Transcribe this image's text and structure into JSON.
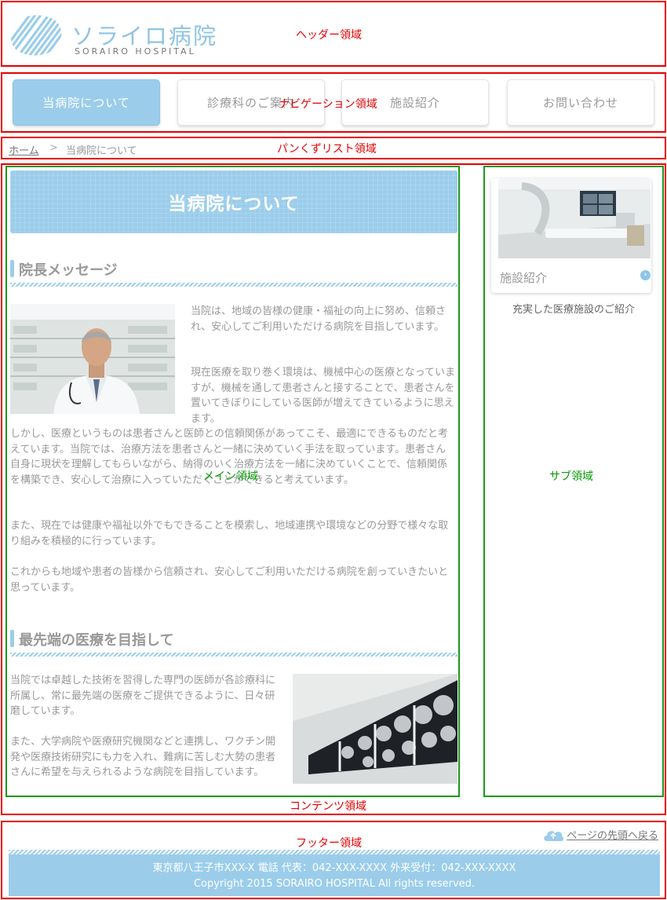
{
  "header": {
    "logo_jp": "ソライロ病院",
    "logo_en": "SORAIRO HOSPITAL",
    "region_label": "ヘッダー領域"
  },
  "nav": {
    "items": [
      {
        "label": "当病院について",
        "active": true
      },
      {
        "label": "診療科のご案内",
        "active": false
      },
      {
        "label": "施設紹介",
        "active": false
      },
      {
        "label": "お問い合わせ",
        "active": false
      }
    ],
    "region_label": "ナビゲーション領域"
  },
  "breadcrumb": {
    "home": "ホーム",
    "separator": ">",
    "current": "当病院について",
    "region_label": "パンくずリスト領域"
  },
  "main": {
    "page_title": "当病院について",
    "region_label": "メイン領域",
    "section1": {
      "heading": "院長メッセージ",
      "para_right": "当院は、地域の皆様の健康・福祉の向上に努め、信頼され、安心してご利用いただける病院を目指しています。",
      "para_right2": "現在医療を取り巻く環境は、機械中心の医療となっていますが、機械を通して患者さんと接することで、患者さんを置いてきぼりにしている医師が増えてきているように思えます。",
      "para_full1": "しかし、医療というものは患者さんと医師との信頼関係があってこそ、最適にできるものだと考えています。当院では、治療方法を患者さんと一緒に決めていく手法を取っています。患者さん自身に現状を理解してもらいながら、納得のいく治療方法を一緒に決めていくことで、信頼関係を構築でき、安心して治療に入っていただくことができると考えています。",
      "para_full2": "また、現在では健康や福祉以外でもできることを模索し、地域連携や環境などの分野で様々な取り組みを積極的に行っています。",
      "para_full3": "これからも地域や患者の皆様から信頼され、安心してご利用いただける病院を創っていきたいと思っています。"
    },
    "section2": {
      "heading": "最先端の医療を目指して",
      "para1": "当院では卓越した技術を習得した専門の医師が各診療科に所属し、常に最先端の医療をご提供できるように、日々研磨しています。",
      "para2": "また、大学病院や医療研究機関などと連携し、ワクチン開発や医療技術研究にも力を入れ、難病に苦しむ大勢の患者さんに希望を与えられるような病院を目指しています。"
    }
  },
  "sub": {
    "region_label": "サブ領域",
    "card_label": "施設紹介",
    "card_caption": "充実した医療施設のご紹介"
  },
  "contents": {
    "region_label": "コンテンツ領域"
  },
  "footer": {
    "region_label": "フッター領域",
    "pagetop": "ページの先頭へ戻る",
    "address": "東京都八王子市XXX-X 電話 代表：042-XXX-XXXX 外来受付：042-XXX-XXXX",
    "copyright": "Copyright 2015 SORAIRO HOSPITAL All rights reserved."
  }
}
